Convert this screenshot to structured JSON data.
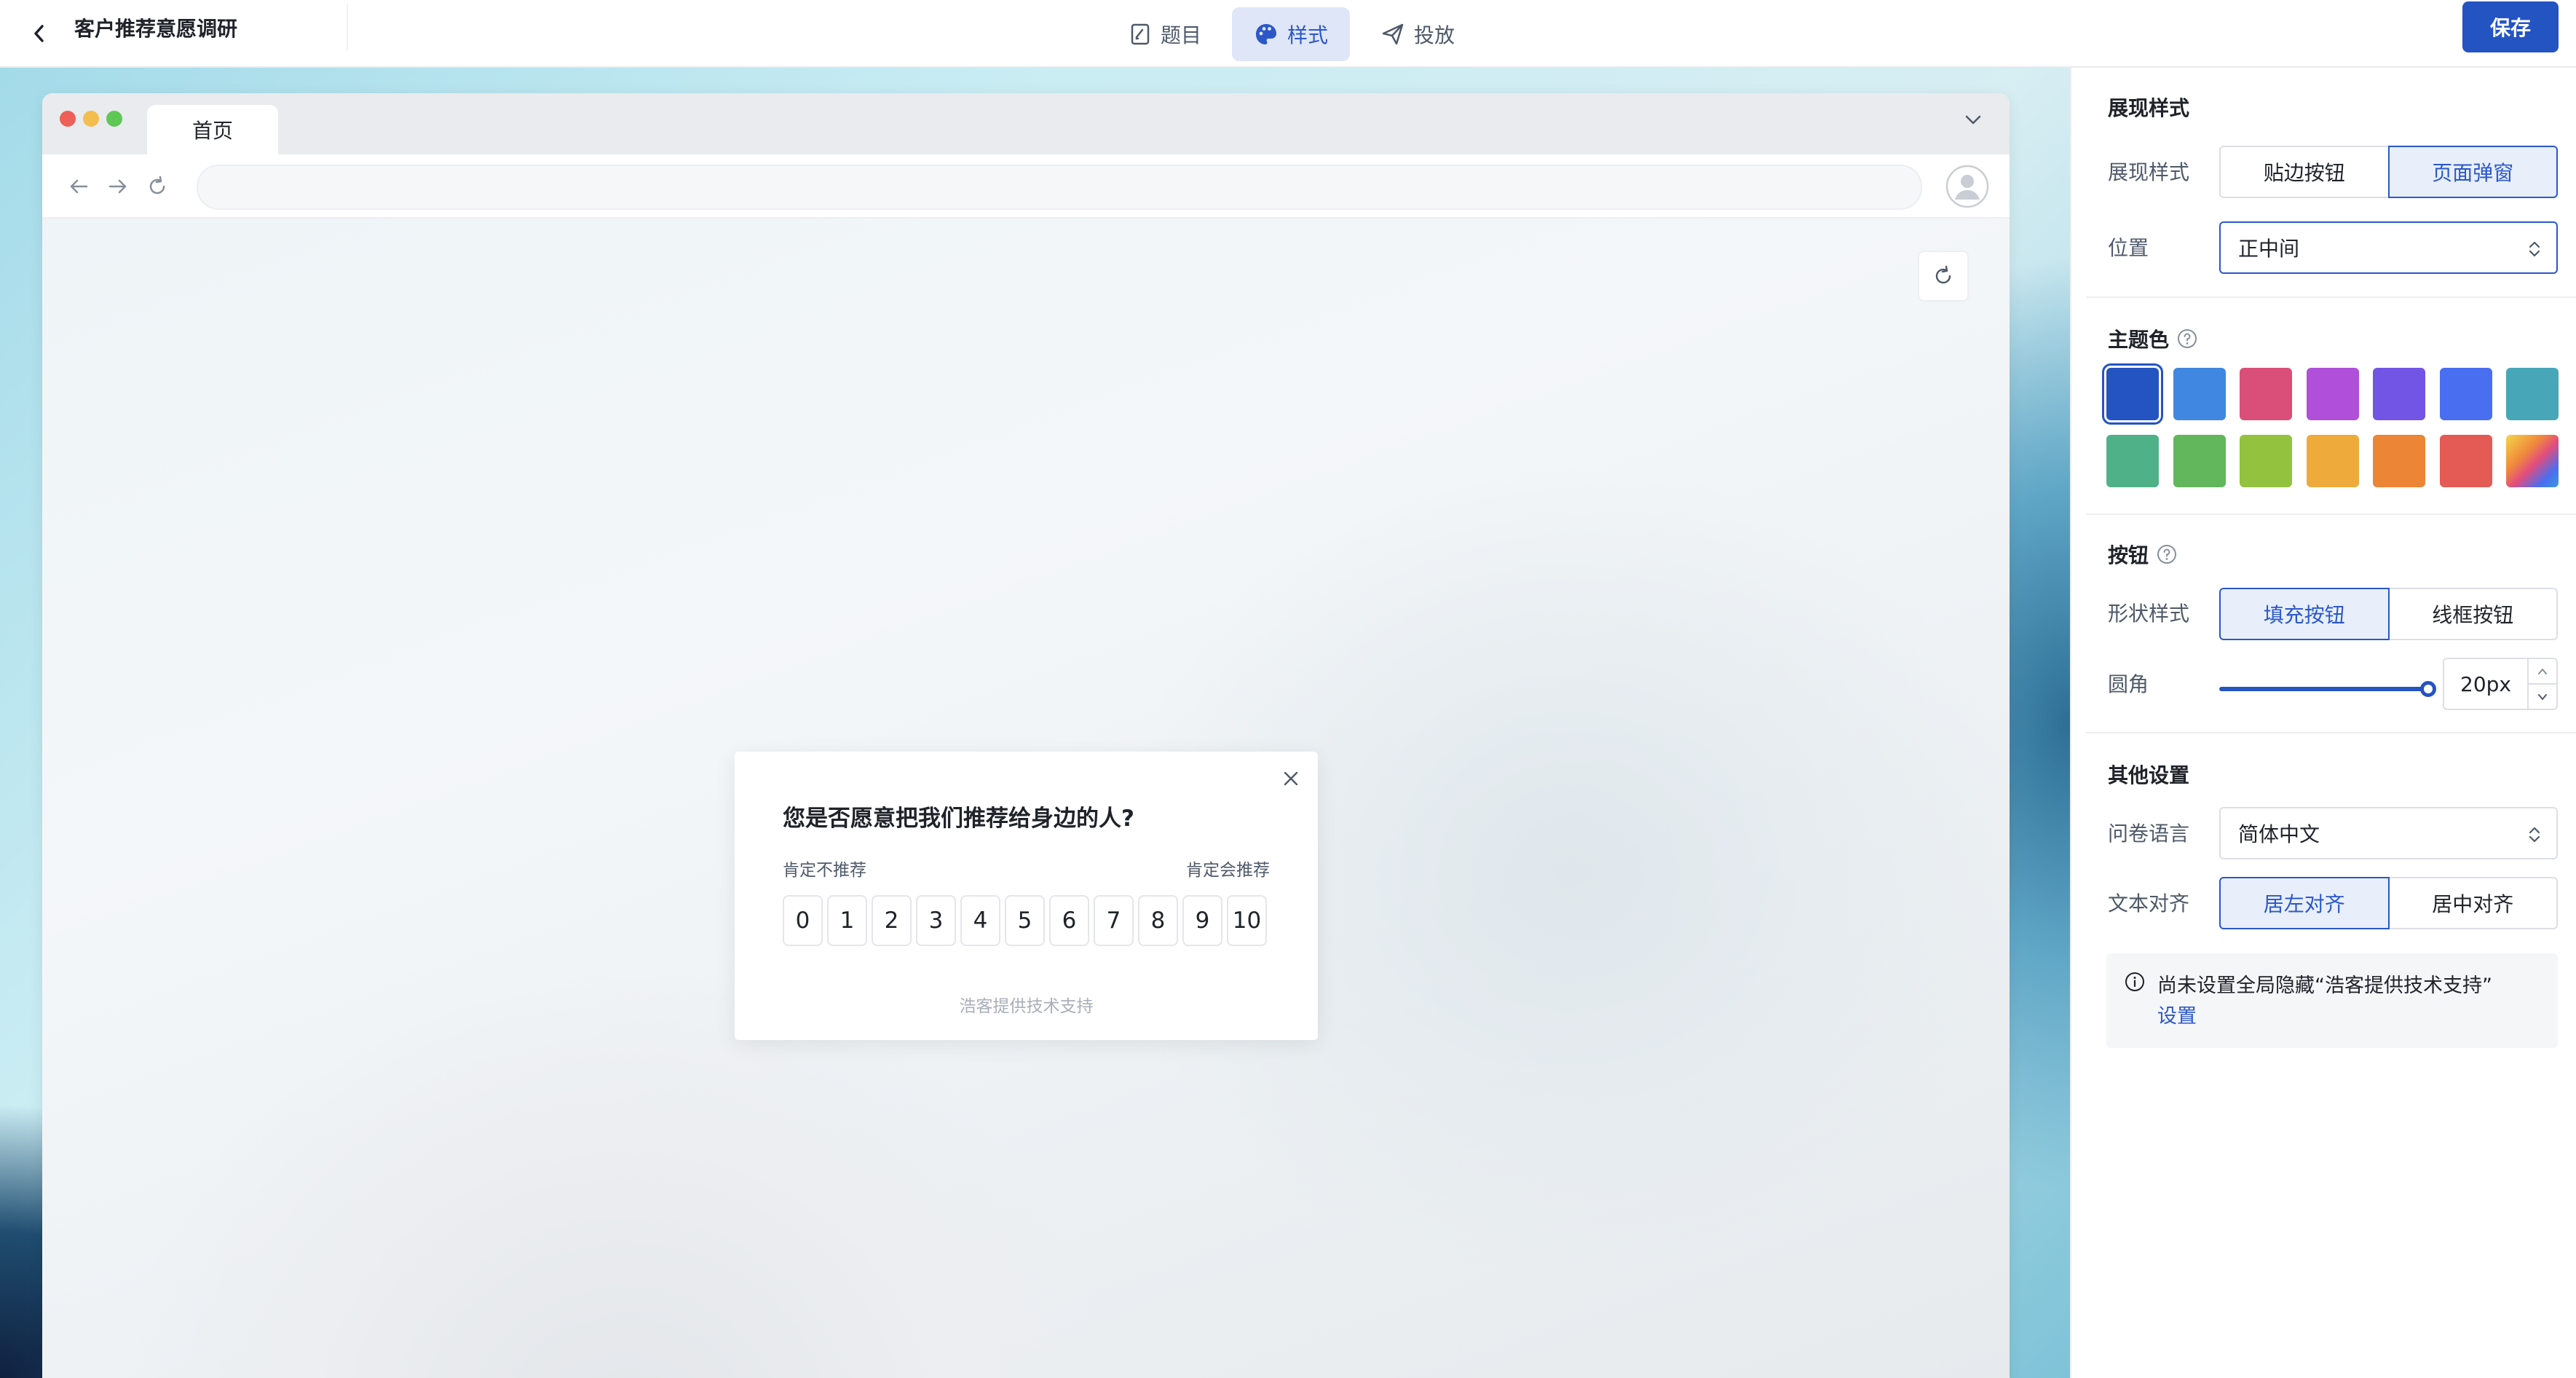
{
  "header": {
    "title": "客户推荐意愿调研",
    "tabs": [
      {
        "label": "题目",
        "icon": "edit-doc-icon",
        "active": false
      },
      {
        "label": "样式",
        "icon": "palette-icon",
        "active": true
      },
      {
        "label": "投放",
        "icon": "send-icon",
        "active": false
      }
    ],
    "save_label": "保存"
  },
  "browser": {
    "tab_label": "首页",
    "address": ""
  },
  "popup": {
    "question": "您是否愿意把我们推荐给身边的人?",
    "left_label": "肯定不推荐",
    "right_label": "肯定会推荐",
    "scale": [
      "0",
      "1",
      "2",
      "3",
      "4",
      "5",
      "6",
      "7",
      "8",
      "9",
      "10"
    ],
    "powered_by": "浩客提供技术支持"
  },
  "panel": {
    "display": {
      "section_title": "展现样式",
      "style_label": "展现样式",
      "style_options": [
        "贴边按钮",
        "页面弹窗"
      ],
      "style_selected": "页面弹窗",
      "position_label": "位置",
      "position_value": "正中间"
    },
    "theme": {
      "section_title": "主题色",
      "colors": [
        "#2453c2",
        "#3f87e0",
        "#d94f7a",
        "#b04fd9",
        "#7355e6",
        "#4a6ef0",
        "#47a6b8",
        "#4fb188",
        "#62b65c",
        "#93c23f",
        "#eeab3c",
        "#ec8535",
        "#e45a54",
        "gradient"
      ],
      "selected_index": 0
    },
    "button": {
      "section_title": "按钮",
      "shape_label": "形状样式",
      "shape_options": [
        "填充按钮",
        "线框按钮"
      ],
      "shape_selected": "填充按钮",
      "radius_label": "圆角",
      "radius_value": "20px",
      "radius_fraction": 1.0
    },
    "other": {
      "section_title": "其他设置",
      "language_label": "问卷语言",
      "language_value": "简体中文",
      "align_label": "文本对齐",
      "align_options": [
        "居左对齐",
        "居中对齐"
      ],
      "align_selected": "居左对齐",
      "notice_text": "尚未设置全局隐藏“浩客提供技术支持”",
      "notice_link": "设置"
    }
  }
}
